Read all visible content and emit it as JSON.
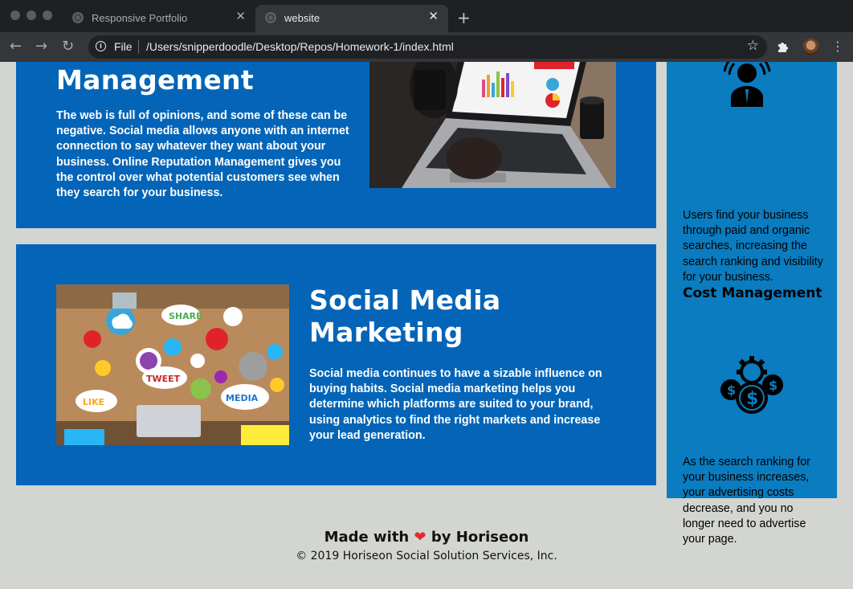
{
  "browser": {
    "tabs": [
      {
        "title": "Responsive Portfolio",
        "active": false
      },
      {
        "title": "website",
        "active": true
      }
    ],
    "new_tab": "+",
    "address": {
      "scheme": "File",
      "url": "/Users/snipperdoodle/Desktop/Repos/Homework-1/index.html"
    }
  },
  "page": {
    "reputation": {
      "heading": "Management",
      "body": "The web is full of opinions, and some of these can be negative. Social media allows anyone with an internet connection to say whatever they want about your business. Online Reputation Management gives you the control over what potential customers see when they search for your business."
    },
    "social": {
      "heading": "Social Media Marketing",
      "body": "Social media continues to have a sizable influence on buying habits. Social media marketing helps you determine which platforms are suited to your brand, using analytics to find the right markets and increase your lead generation."
    },
    "sidebar": {
      "lead_text": "Users find your business through paid and organic searches, increasing the search ranking and visibility for your business.",
      "cost_heading": "Cost Management",
      "cost_text": "As the search ranking for your business increases, your advertising costs decrease, and you no longer need to advertise your page."
    },
    "footer": {
      "made_prefix": "Made with",
      "heart": "❤",
      "made_suffix": "by Horiseon",
      "copyright": "© 2019 Horiseon Social Solution Services, Inc."
    }
  },
  "colors": {
    "card_blue": "#0465b8",
    "sidebar_blue": "#0a7cbf",
    "page_background": "#d3d6d0"
  }
}
